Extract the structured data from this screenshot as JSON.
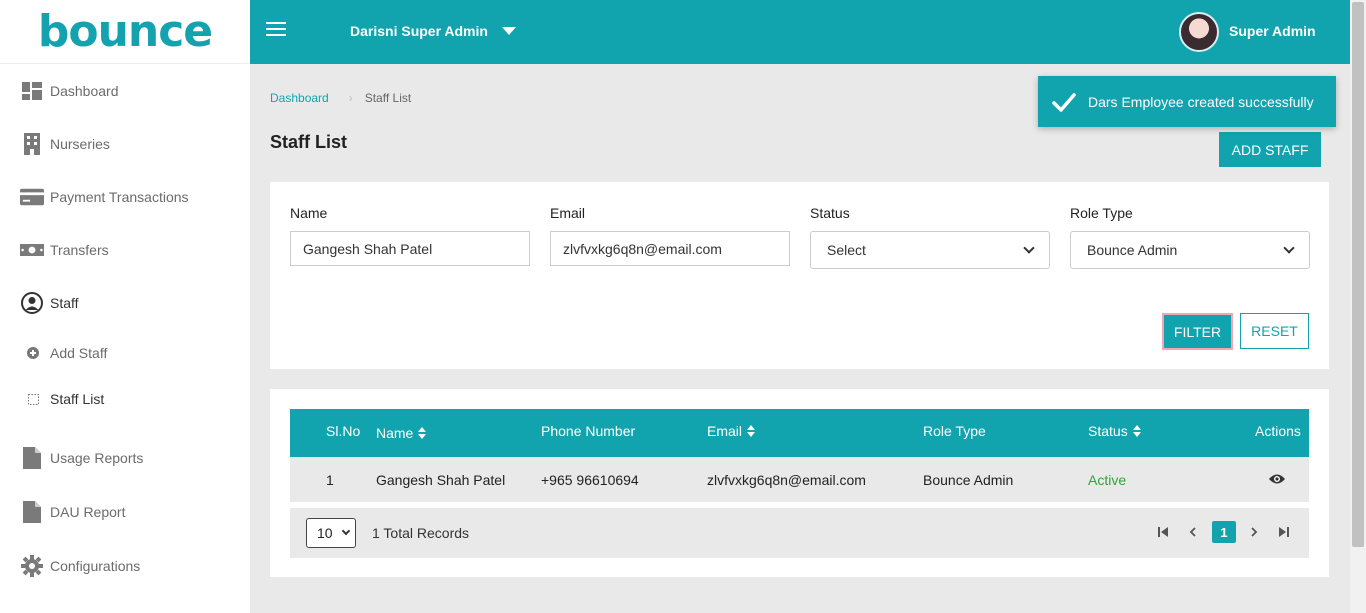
{
  "app": {
    "logo_text": "bounce",
    "brand_color": "#12a4ae"
  },
  "sidebar": {
    "items": [
      {
        "label": "Dashboard",
        "icon": "dashboard-icon"
      },
      {
        "label": "Nurseries",
        "icon": "building-icon"
      },
      {
        "label": "Payment Transactions",
        "icon": "credit-card-icon"
      },
      {
        "label": "Transfers",
        "icon": "money-icon"
      },
      {
        "label": "Staff",
        "icon": "user-circle-icon"
      },
      {
        "label": "Usage Reports",
        "icon": "document-icon"
      },
      {
        "label": "DAU Report",
        "icon": "document-icon"
      },
      {
        "label": "Configurations",
        "icon": "gear-icon"
      }
    ],
    "staff_sub": [
      {
        "label": "Add Staff",
        "icon": "plus-circle-icon"
      },
      {
        "label": "Staff List",
        "icon": "dotted-square-icon"
      }
    ]
  },
  "header": {
    "org_name": "Darisni Super Admin",
    "user_name": "Super Admin"
  },
  "breadcrumb": {
    "home": "Dashboard",
    "current": "Staff List"
  },
  "page": {
    "title": "Staff List",
    "add_button": "ADD STAFF"
  },
  "toast": {
    "message": "Dars Employee created successfully"
  },
  "filters": {
    "name_label": "Name",
    "name_value": "Gangesh Shah Patel",
    "email_label": "Email",
    "email_value": "zlvfvxkg6q8n@email.com",
    "status_label": "Status",
    "status_value": "Select",
    "role_label": "Role Type",
    "role_value": "Bounce Admin",
    "filter_button": "FILTER",
    "reset_button": "RESET"
  },
  "table": {
    "columns": [
      "Sl.No",
      "Name",
      "Phone Number",
      "Email",
      "Role Type",
      "Status",
      "Actions"
    ],
    "rows": [
      {
        "sl": "1",
        "name": "Gangesh Shah Patel",
        "phone": "+965 96610694",
        "email": "zlvfvxkg6q8n@email.com",
        "role": "Bounce Admin",
        "status": "Active"
      }
    ]
  },
  "pagination": {
    "page_size": "10",
    "total_records": "1 Total Records",
    "current_page": "1"
  }
}
